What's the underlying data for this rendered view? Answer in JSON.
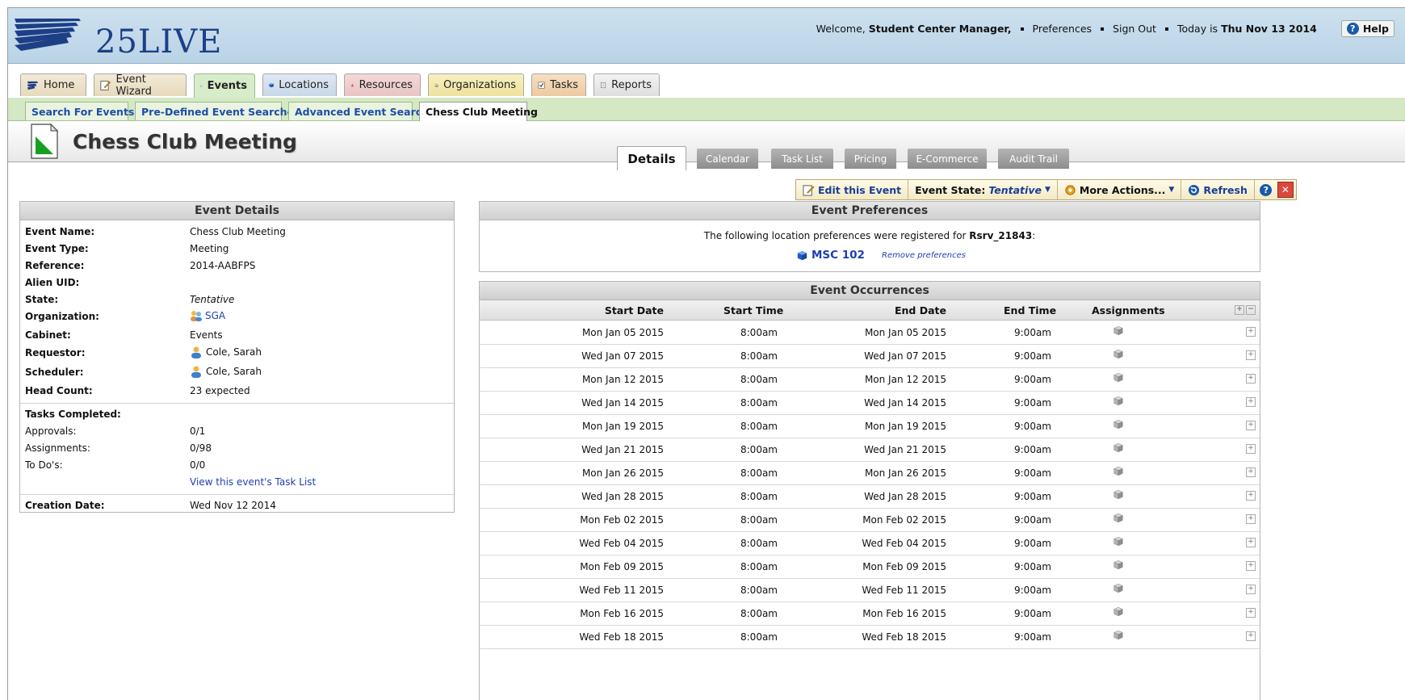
{
  "header": {
    "logo_text": "25LIVE",
    "welcome_prefix": "Welcome,",
    "user_name": "Student Center Manager,",
    "preferences": "Preferences",
    "sign_out": "Sign Out",
    "today_prefix": "Today is",
    "today_date": "Thu Nov 13 2014",
    "help": "Help"
  },
  "main_tabs": [
    {
      "label": "Home",
      "icon": "home-icon"
    },
    {
      "label": "Event Wizard",
      "icon": "pencil-icon"
    },
    {
      "label": "Events",
      "icon": "event-doc-icon"
    },
    {
      "label": "Locations",
      "icon": "cube-icon"
    },
    {
      "label": "Resources",
      "icon": "cone-icon"
    },
    {
      "label": "Organizations",
      "icon": "people-icon"
    },
    {
      "label": "Tasks",
      "icon": "checkbox-icon"
    },
    {
      "label": "Reports",
      "icon": "report-icon"
    }
  ],
  "sub_tabs": [
    "Search For Events",
    "Pre-Defined Event Searches",
    "Advanced Event Search",
    "Chess Club Meeting"
  ],
  "page_title": "Chess Club Meeting",
  "detail_tabs": [
    "Details",
    "Calendar",
    "Task List",
    "Pricing",
    "E-Commerce",
    "Audit Trail"
  ],
  "toolbar": {
    "edit": "Edit this Event",
    "state_label": "Event State:",
    "state_value": "Tentative",
    "more": "More Actions...",
    "refresh": "Refresh"
  },
  "event_details": {
    "title": "Event Details",
    "rows": [
      {
        "label": "Event Name:",
        "value": "Chess Club Meeting"
      },
      {
        "label": "Event Type:",
        "value": "Meeting"
      },
      {
        "label": "Reference:",
        "value": "2014-AABFPS"
      },
      {
        "label": "Alien UID:",
        "value": ""
      },
      {
        "label": "State:",
        "value": "Tentative"
      },
      {
        "label": "Organization:",
        "value": "SGA"
      },
      {
        "label": "Cabinet:",
        "value": "Events"
      },
      {
        "label": "Requestor:",
        "value": "Cole, Sarah"
      },
      {
        "label": "Scheduler:",
        "value": "Cole, Sarah"
      },
      {
        "label": "Head Count:",
        "value": "23 expected"
      }
    ],
    "tasks_label": "Tasks Completed:",
    "tasks": [
      {
        "label": "Approvals:",
        "value": "0/1"
      },
      {
        "label": "Assignments:",
        "value": "0/98"
      },
      {
        "label": "To Do's:",
        "value": "0/0"
      }
    ],
    "task_link": "View this event's Task List",
    "creation_label": "Creation Date:",
    "creation_value": "Wed Nov 12 2014"
  },
  "preferences": {
    "title": "Event Preferences",
    "text_prefix": "The following location preferences were registered for",
    "reservation": "Rsrv_21843",
    "text_suffix": ":",
    "location": "MSC 102",
    "remove": "Remove preferences"
  },
  "occurrences": {
    "title": "Event Occurrences",
    "columns": [
      "Start Date",
      "Start Time",
      "End Date",
      "End Time",
      "Assignments"
    ],
    "rows": [
      {
        "start_date": "Mon Jan 05 2015",
        "start_time": "8:00am",
        "end_date": "Mon Jan 05 2015",
        "end_time": "9:00am"
      },
      {
        "start_date": "Wed Jan 07 2015",
        "start_time": "8:00am",
        "end_date": "Wed Jan 07 2015",
        "end_time": "9:00am"
      },
      {
        "start_date": "Mon Jan 12 2015",
        "start_time": "8:00am",
        "end_date": "Mon Jan 12 2015",
        "end_time": "9:00am"
      },
      {
        "start_date": "Wed Jan 14 2015",
        "start_time": "8:00am",
        "end_date": "Wed Jan 14 2015",
        "end_time": "9:00am"
      },
      {
        "start_date": "Mon Jan 19 2015",
        "start_time": "8:00am",
        "end_date": "Mon Jan 19 2015",
        "end_time": "9:00am"
      },
      {
        "start_date": "Wed Jan 21 2015",
        "start_time": "8:00am",
        "end_date": "Wed Jan 21 2015",
        "end_time": "9:00am"
      },
      {
        "start_date": "Mon Jan 26 2015",
        "start_time": "8:00am",
        "end_date": "Mon Jan 26 2015",
        "end_time": "9:00am"
      },
      {
        "start_date": "Wed Jan 28 2015",
        "start_time": "8:00am",
        "end_date": "Wed Jan 28 2015",
        "end_time": "9:00am"
      },
      {
        "start_date": "Mon Feb 02 2015",
        "start_time": "8:00am",
        "end_date": "Mon Feb 02 2015",
        "end_time": "9:00am"
      },
      {
        "start_date": "Wed Feb 04 2015",
        "start_time": "8:00am",
        "end_date": "Wed Feb 04 2015",
        "end_time": "9:00am"
      },
      {
        "start_date": "Mon Feb 09 2015",
        "start_time": "8:00am",
        "end_date": "Mon Feb 09 2015",
        "end_time": "9:00am"
      },
      {
        "start_date": "Wed Feb 11 2015",
        "start_time": "8:00am",
        "end_date": "Wed Feb 11 2015",
        "end_time": "9:00am"
      },
      {
        "start_date": "Mon Feb 16 2015",
        "start_time": "8:00am",
        "end_date": "Mon Feb 16 2015",
        "end_time": "9:00am"
      },
      {
        "start_date": "Wed Feb 18 2015",
        "start_time": "8:00am",
        "end_date": "Wed Feb 18 2015",
        "end_time": "9:00am"
      }
    ]
  },
  "colors": {
    "header_bg": "#c4dbeb",
    "subnav_bg": "#d3e8c3",
    "link": "#1f3fb0",
    "toolbar_bg": "#f6edc9"
  }
}
